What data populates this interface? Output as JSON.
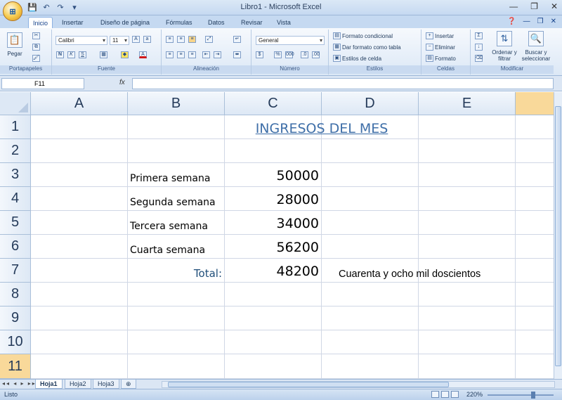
{
  "window": {
    "title": "Libro1 - Microsoft Excel",
    "office_button": "⊞",
    "controls": [
      "—",
      "❐",
      "✕"
    ]
  },
  "quick_access": [
    "💾",
    "↶",
    "↷",
    "▾"
  ],
  "tabs": [
    "Inicio",
    "Insertar",
    "Diseño de página",
    "Fórmulas",
    "Datos",
    "Revisar",
    "Vista"
  ],
  "ribbon": {
    "groups": {
      "clipboard": "Portapapeles",
      "font": "Fuente",
      "alignment": "Alineación",
      "number": "Número",
      "styles": "Estilos",
      "cells": "Celdas",
      "modify": "Modificar"
    },
    "paste_label": "Pegar",
    "font_name": "Calibri",
    "font_size": "11",
    "number_format": "General",
    "styles_items": [
      "Formato condicional",
      "Dar formato como tabla",
      "Estilos de celda"
    ],
    "cells_items": [
      "Insertar",
      "Eliminar",
      "Formato"
    ],
    "modify_items": [
      "Ordenar y filtrar",
      "Buscar y seleccionar"
    ]
  },
  "formula_bar": {
    "name_box": "F11",
    "fx_label": "fx",
    "formula": ""
  },
  "columns": [
    "A",
    "B",
    "C",
    "D",
    "E"
  ],
  "rows": [
    "1",
    "2",
    "3",
    "4",
    "5",
    "6",
    "7",
    "8",
    "9",
    "10",
    "11"
  ],
  "cells": {
    "C1": "INGRESOS DEL MES",
    "B3": "Primera semana",
    "C3": "50000",
    "B4": "Segunda semana",
    "C4": "28000",
    "B5": "Tercera semana",
    "C5": "34000",
    "B6": "Cuarta semana",
    "C6": "56200",
    "B7": "Total:",
    "C7": "48200",
    "D7": "Cuarenta y ocho mil doscientos"
  },
  "sheets": [
    "Hoja1",
    "Hoja2",
    "Hoja3"
  ],
  "status": {
    "mode": "Listo",
    "zoom": "220%"
  },
  "colors": {
    "title_text": "#3f6fa8",
    "selected_row_header": "#f9d99a",
    "ribbon_accent": "#15428b"
  }
}
